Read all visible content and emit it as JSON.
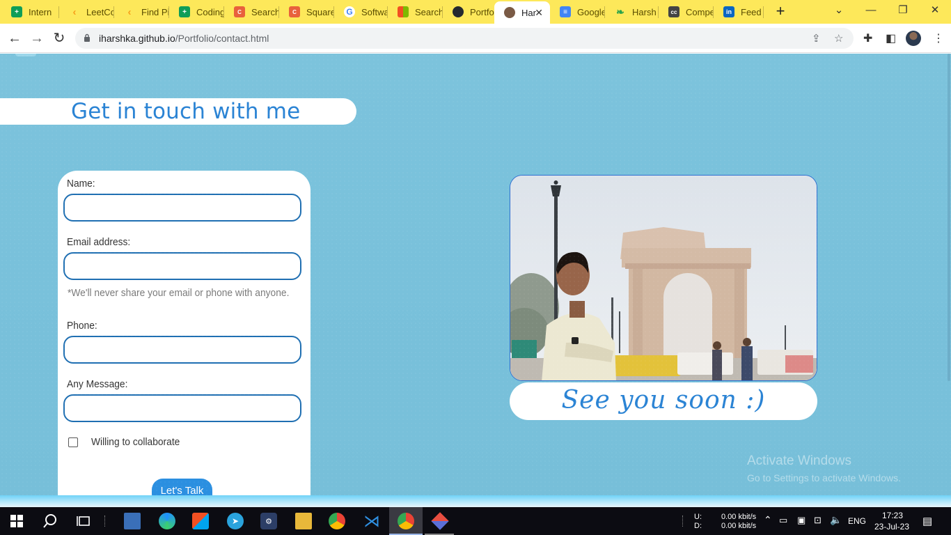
{
  "browser": {
    "tabs": [
      {
        "title": "Intern",
        "favicon": "google-sheets-icon",
        "color": "#0f9d58"
      },
      {
        "title": "LeetCo",
        "favicon": "leetcode-icon",
        "color": "#f89f1b"
      },
      {
        "title": "Find Pi",
        "favicon": "leetcode-icon",
        "color": "#f89f1b"
      },
      {
        "title": "Coding",
        "favicon": "google-sheets-icon",
        "color": "#0f9d58"
      },
      {
        "title": "Search",
        "favicon": "codechef-icon",
        "color": "#e8613c"
      },
      {
        "title": "Square",
        "favicon": "codechef-icon",
        "color": "#e8613c"
      },
      {
        "title": "Softwa",
        "favicon": "google-icon",
        "color": "#4285f4"
      },
      {
        "title": "Search",
        "favicon": "microsoft-icon",
        "color": "#f25022"
      },
      {
        "title": "Portfoli",
        "favicon": "github-icon",
        "color": "#24292f"
      },
      {
        "title": "Har",
        "favicon": "profile-favicon-icon",
        "color": "#7a5a45",
        "active": true
      },
      {
        "title": "Google",
        "favicon": "google-docs-icon",
        "color": "#4285f4"
      },
      {
        "title": "Harsh",
        "favicon": "shopify-leaf-icon",
        "color": "#2aa24a"
      },
      {
        "title": "Compe",
        "favicon": "codechef-cc-icon",
        "color": "#444444"
      },
      {
        "title": "Feed |",
        "favicon": "linkedin-icon",
        "color": "#0a66c2"
      }
    ],
    "url_host": "iharshka.github.io",
    "url_path": "/Portfolio/contact.html"
  },
  "page": {
    "heading": "Get in touch with me",
    "form": {
      "name_label": "Name:",
      "email_label": "Email address:",
      "email_note": "*We'll never share your email or phone with anyone.",
      "phone_label": "Phone:",
      "message_label": "Any Message:",
      "collab_label": "Willing to collaborate",
      "collab_checked": false,
      "submit_label": "Let's Talk"
    },
    "sign_off": "See you soon :)"
  },
  "watermark": {
    "line1": "Activate Windows",
    "line2": "Go to Settings to activate Windows."
  },
  "taskbar": {
    "net_up_label": "U:",
    "net_down_label": "D:",
    "net_up": "0.00 kbit/s",
    "net_down": "0.00 kbit/s",
    "language": "ENG",
    "time": "17:23",
    "date": "23-Jul-23"
  },
  "colors": {
    "accent": "#2a83d4",
    "page_bg": "#7cc3dc",
    "tabstrip": "#fde85a",
    "input_border": "#1f6fb2",
    "button": "#2b8fe0"
  }
}
